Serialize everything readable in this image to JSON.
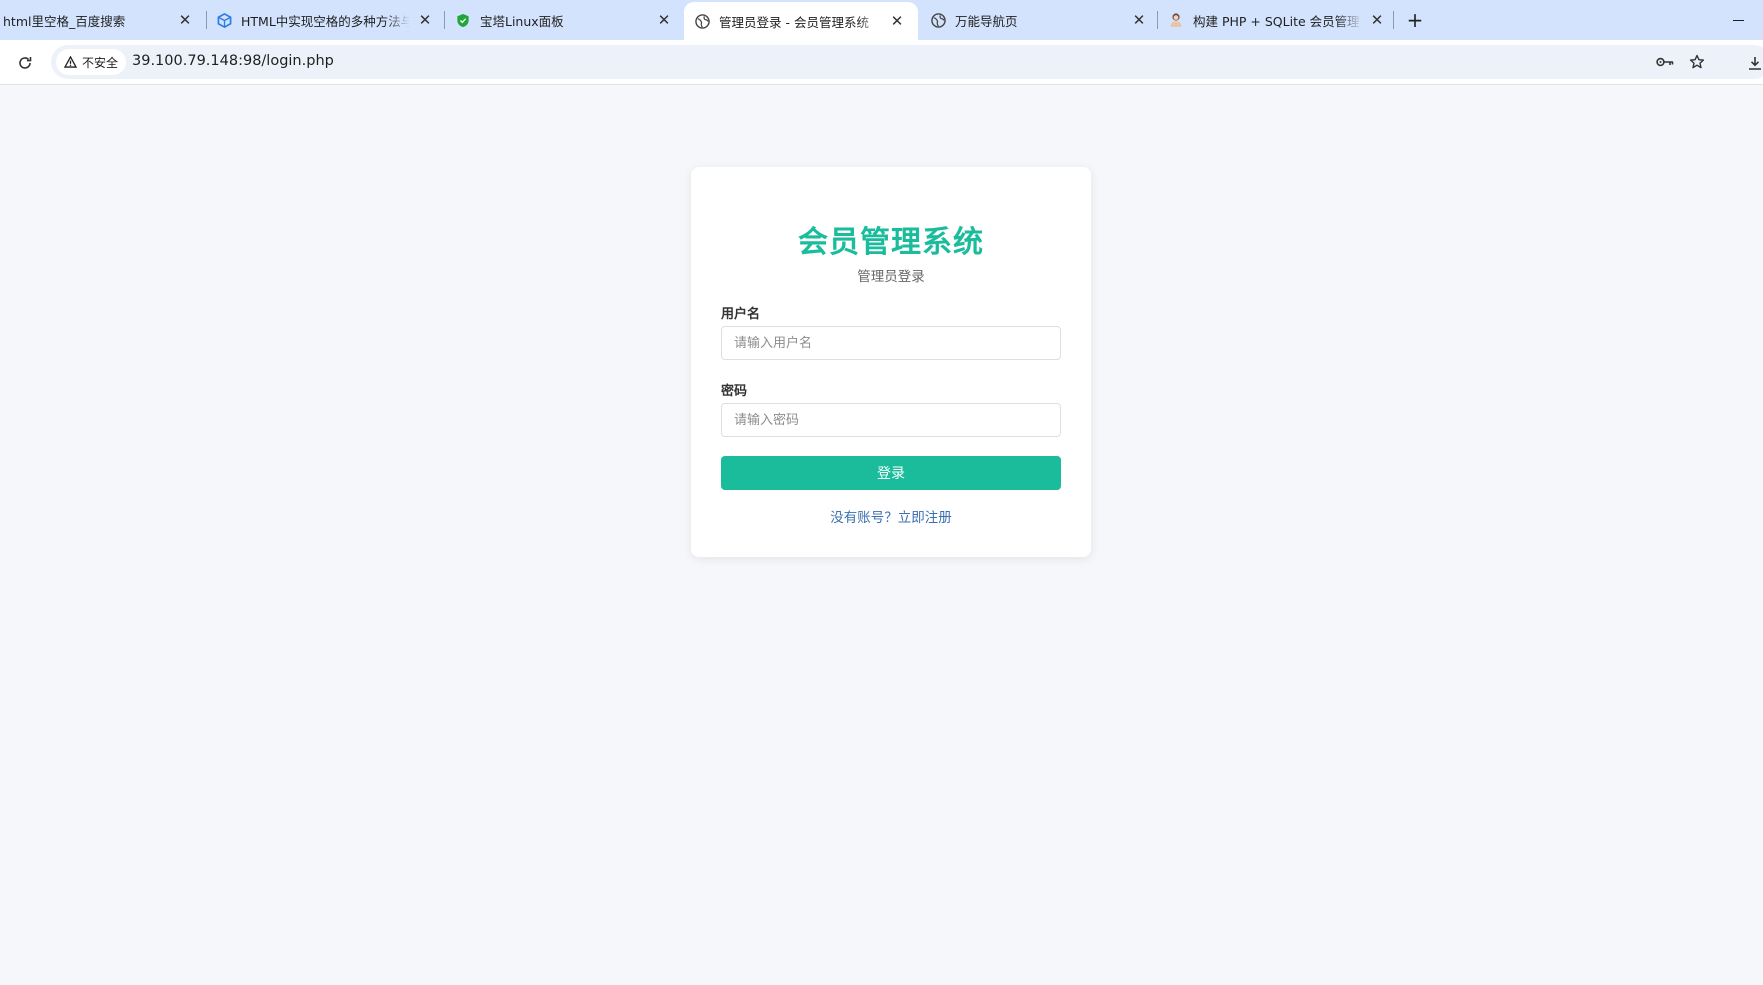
{
  "browser": {
    "tabs": [
      {
        "title": "html里空格_百度搜索",
        "favicon": "baidu-icon",
        "active": false
      },
      {
        "title": "HTML中实现空格的多种方法与",
        "favicon": "cube-icon",
        "active": false
      },
      {
        "title": "宝塔Linux面板",
        "favicon": "shield-icon",
        "active": false
      },
      {
        "title": "管理员登录 - 会员管理系统",
        "favicon": "globe-icon",
        "active": true
      },
      {
        "title": "万能导航页",
        "favicon": "globe-icon",
        "active": false
      },
      {
        "title": "构建 PHP + SQLite 会员管理系",
        "favicon": "avatar-icon",
        "active": false
      }
    ],
    "security_label": "不安全",
    "url": "39.100.79.148:98/login.php"
  },
  "login": {
    "title": "会员管理系统",
    "subtitle": "管理员登录",
    "username_label": "用户名",
    "username_placeholder": "请输入用户名",
    "password_label": "密码",
    "password_placeholder": "请输入密码",
    "submit_label": "登录",
    "register_link": "没有账号？立即注册"
  },
  "colors": {
    "accent": "#1abc9c",
    "link": "#3a6fb0",
    "page_background": "#f5f7fa",
    "tabstrip": "#d3e3fd"
  }
}
